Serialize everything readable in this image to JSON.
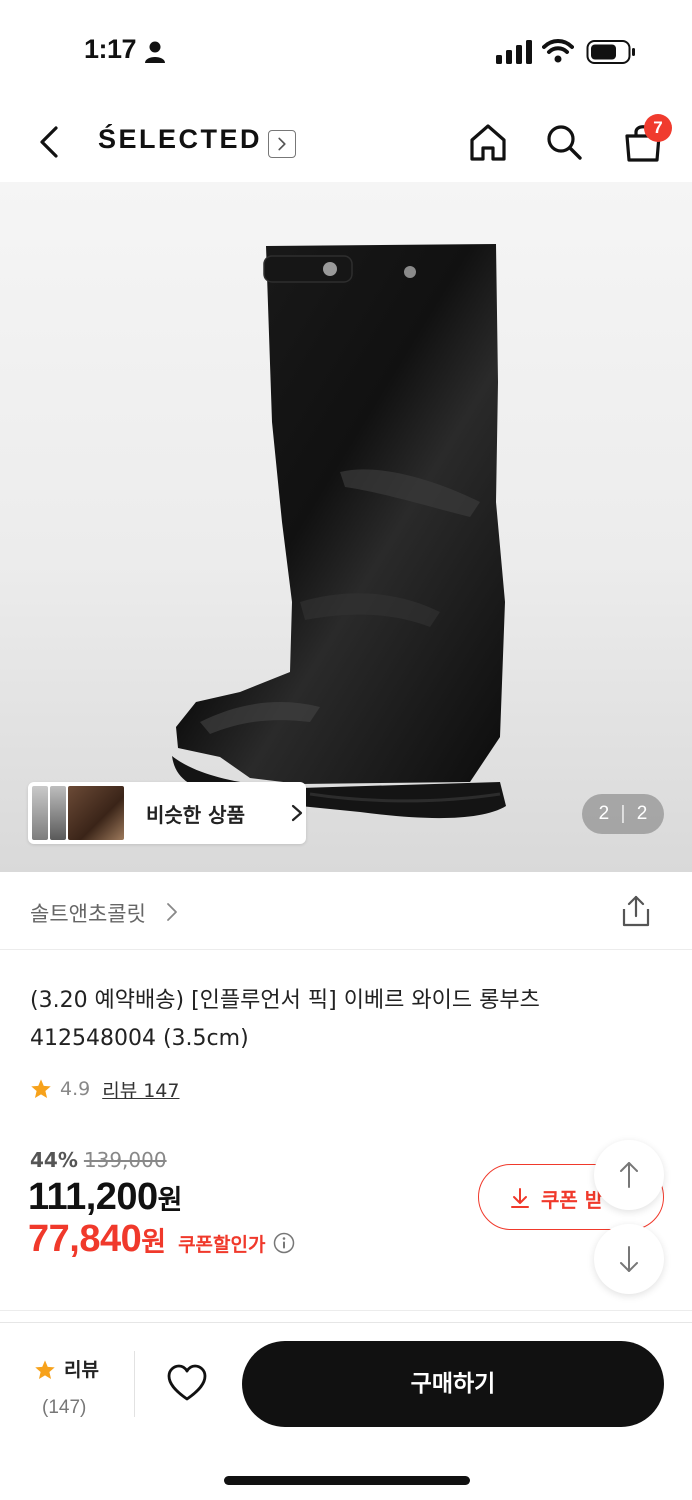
{
  "status_bar": {
    "time": "1:17",
    "icons": [
      "person-icon",
      "signal-icon",
      "wifi-icon",
      "battery-icon"
    ]
  },
  "header": {
    "brand": "ŚELECTED",
    "cart_count": "7",
    "icons": [
      "back-icon",
      "brand-arrow-icon",
      "home-icon",
      "search-icon",
      "cart-icon"
    ]
  },
  "gallery": {
    "similar_label": "비슷한 상품",
    "page_current": "2",
    "page_separator": "|",
    "page_total": "2"
  },
  "store": {
    "name": "솔트앤초콜릿"
  },
  "product": {
    "title_line1": "(3.20 예약배송) [인플루언서 픽] 이베르 와이드 롱부츠",
    "title_line2": "412548004 (3.5cm)",
    "rating": "4.9",
    "review_link": "리뷰 147"
  },
  "price": {
    "discount_rate": "44%",
    "original_price": "139,000",
    "sale_price": "111,200",
    "currency": "원",
    "coupon_price": "77,840",
    "coupon_price_label": "쿠폰할인가",
    "coupon_button_label": "쿠폰 받"
  },
  "bottom_bar": {
    "review_label": "리뷰",
    "review_count": "(147)",
    "buy_label": "구매하기"
  },
  "colors": {
    "accent_red": "#f0392b",
    "star": "#f7a21b",
    "buy_button": "#111111"
  }
}
